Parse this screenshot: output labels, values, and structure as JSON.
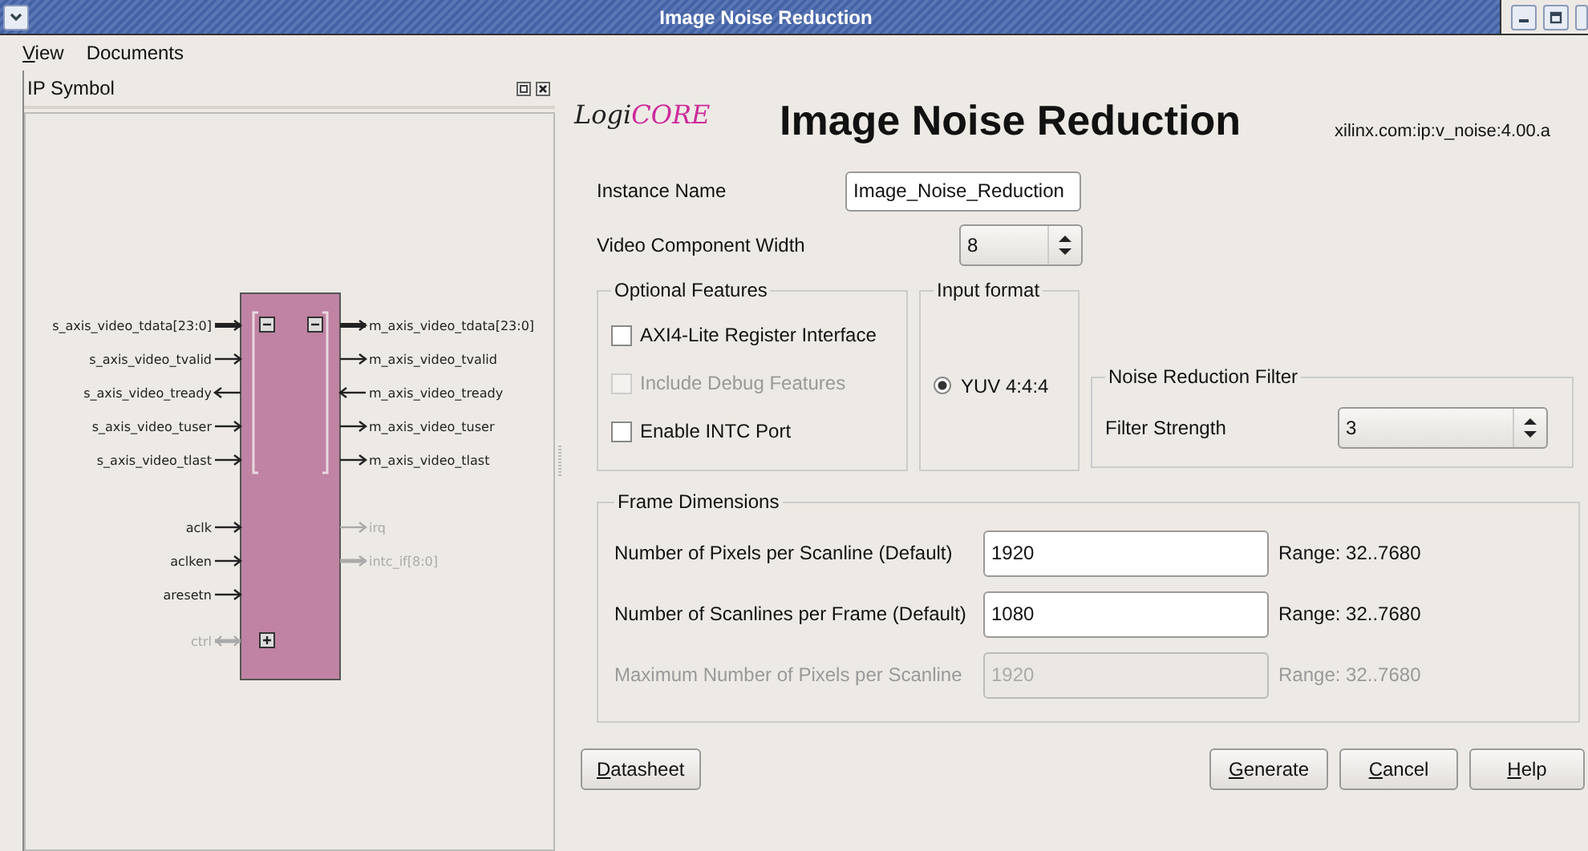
{
  "window": {
    "title": "Image Noise Reduction"
  },
  "menu": [
    {
      "label": "View",
      "mnemonic": true
    },
    {
      "label": "Documents",
      "mnemonic": false
    }
  ],
  "ip_symbol": {
    "title": "IP Symbol",
    "left": [
      {
        "kind": "interface",
        "expanded": true,
        "ports": [
          {
            "label": "s_axis_video_tdata[23:0]",
            "kind": "in",
            "bus": true,
            "disabled": false
          },
          {
            "label": "s_axis_video_tvalid",
            "kind": "in",
            "bus": false,
            "disabled": false
          },
          {
            "label": "s_axis_video_tready",
            "kind": "out",
            "bus": false,
            "disabled": false
          },
          {
            "label": "s_axis_video_tuser",
            "kind": "in",
            "bus": false,
            "disabled": false
          },
          {
            "label": "s_axis_video_tlast",
            "kind": "in",
            "bus": false,
            "disabled": false
          }
        ]
      },
      {
        "kind": "plain",
        "ports": [
          {
            "label": "aclk",
            "kind": "in",
            "bus": false,
            "disabled": false
          },
          {
            "label": "aclken",
            "kind": "in",
            "bus": false,
            "disabled": false
          },
          {
            "label": "aresetn",
            "kind": "in",
            "bus": false,
            "disabled": false
          }
        ]
      },
      {
        "kind": "interface",
        "expanded": false,
        "ports": [
          {
            "label": "ctrl",
            "kind": "bidir",
            "bus": true,
            "disabled": true
          }
        ]
      }
    ],
    "right": [
      {
        "kind": "interface",
        "expanded": true,
        "ports": [
          {
            "label": "m_axis_video_tdata[23:0]",
            "kind": "out",
            "bus": true,
            "disabled": false
          },
          {
            "label": "m_axis_video_tvalid",
            "kind": "out",
            "bus": false,
            "disabled": false
          },
          {
            "label": "m_axis_video_tready",
            "kind": "in",
            "bus": false,
            "disabled": false
          },
          {
            "label": "m_axis_video_tuser",
            "kind": "out",
            "bus": false,
            "disabled": false
          },
          {
            "label": "m_axis_video_tlast",
            "kind": "out",
            "bus": false,
            "disabled": false
          }
        ]
      },
      {
        "kind": "plain",
        "ports": [
          {
            "label": "irq",
            "kind": "out",
            "bus": false,
            "disabled": true
          },
          {
            "label": "intc_if[8:0]",
            "kind": "out",
            "bus": true,
            "disabled": true
          }
        ]
      }
    ]
  },
  "header": {
    "logo": "LogiCORE",
    "title": "Image Noise Reduction",
    "version": "xilinx.com:ip:v_noise:4.00.a"
  },
  "instance_name": {
    "label": "Instance Name",
    "value": "Image_Noise_Reduction"
  },
  "component_width": {
    "label": "Video Component Width",
    "value": "8"
  },
  "optional_features": {
    "title": "Optional Features",
    "options": [
      {
        "label": "AXI4-Lite Register Interface",
        "checked": false,
        "disabled": false
      },
      {
        "label": "Include Debug Features",
        "checked": false,
        "disabled": true
      },
      {
        "label": "Enable INTC Port",
        "checked": false,
        "disabled": false
      }
    ]
  },
  "input_format": {
    "title": "Input format",
    "options": [
      {
        "label": "YUV 4:4:4",
        "selected": true
      }
    ]
  },
  "noise_filter": {
    "title": "Noise Reduction Filter",
    "label": "Filter Strength",
    "value": "3"
  },
  "frame_dimensions": {
    "title": "Frame Dimensions",
    "rows": [
      {
        "label": "Number of Pixels per Scanline (Default)",
        "value": "1920",
        "range": "Range: 32..7680",
        "disabled": false
      },
      {
        "label": "Number of Scanlines per Frame (Default)",
        "value": "1080",
        "range": "Range: 32..7680",
        "disabled": false
      },
      {
        "label": "Maximum Number of Pixels per Scanline",
        "value": "1920",
        "range": "Range: 32..7680",
        "disabled": true
      }
    ]
  },
  "buttons_left": [
    {
      "label": "Datasheet",
      "mnemonic": true
    }
  ],
  "buttons_right": [
    {
      "label": "Generate",
      "mnemonic": true
    },
    {
      "label": "Cancel",
      "mnemonic": true
    },
    {
      "label": "Help",
      "mnemonic": true
    }
  ]
}
